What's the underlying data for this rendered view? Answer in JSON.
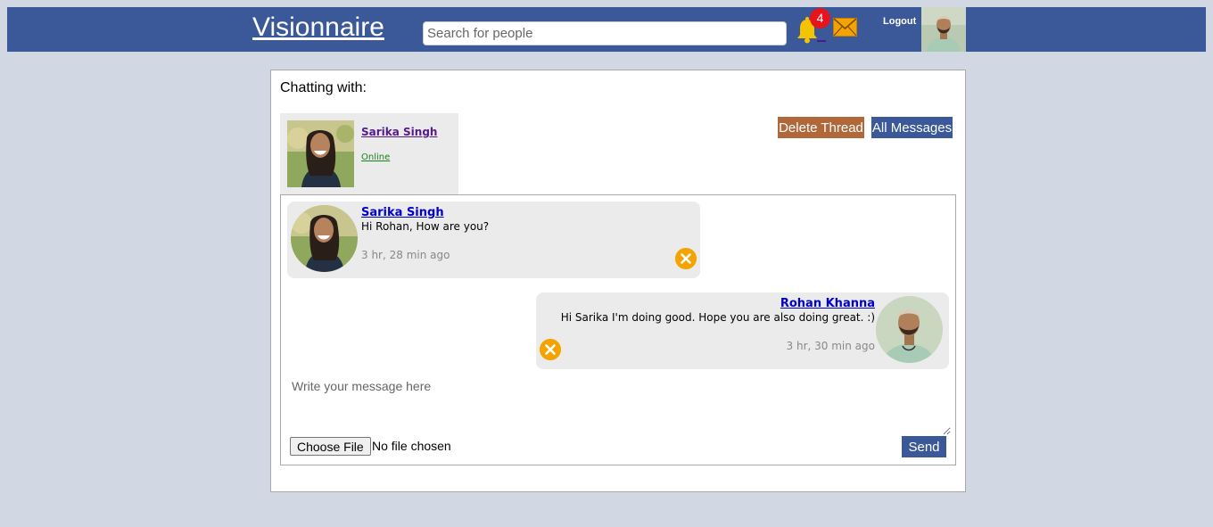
{
  "header": {
    "brand": "Visionnaire",
    "search_placeholder": "Search for people",
    "notification_count": "4",
    "logout_label": "Logout"
  },
  "chat": {
    "title": "Chatting with:",
    "contact": {
      "name": "Sarika Singh",
      "status": "Online"
    },
    "delete_thread_label": "Delete Thread",
    "all_messages_label": "All Messages"
  },
  "messages": [
    {
      "sender": "Sarika Singh",
      "text": "Hi Rohan, How are you?",
      "time": "3 hr, 28 min ago",
      "direction": "incoming"
    },
    {
      "sender": "Rohan Khanna",
      "text": "Hi Sarika I'm doing good. Hope you are also doing great. :)",
      "time": "3 hr, 30 min ago",
      "direction": "outgoing"
    }
  ],
  "composer": {
    "placeholder": "Write your message here",
    "file_button_label": "Choose File",
    "file_status": "No file chosen",
    "send_label": "Send"
  },
  "colors": {
    "header_bg": "#3b5998",
    "page_bg": "#d2d8e3",
    "delete_button": "#b0683a",
    "badge": "#e8141c",
    "icon_accent": "#f5a300"
  },
  "icons": [
    "bell-icon",
    "mail-icon",
    "close-circle-icon"
  ]
}
